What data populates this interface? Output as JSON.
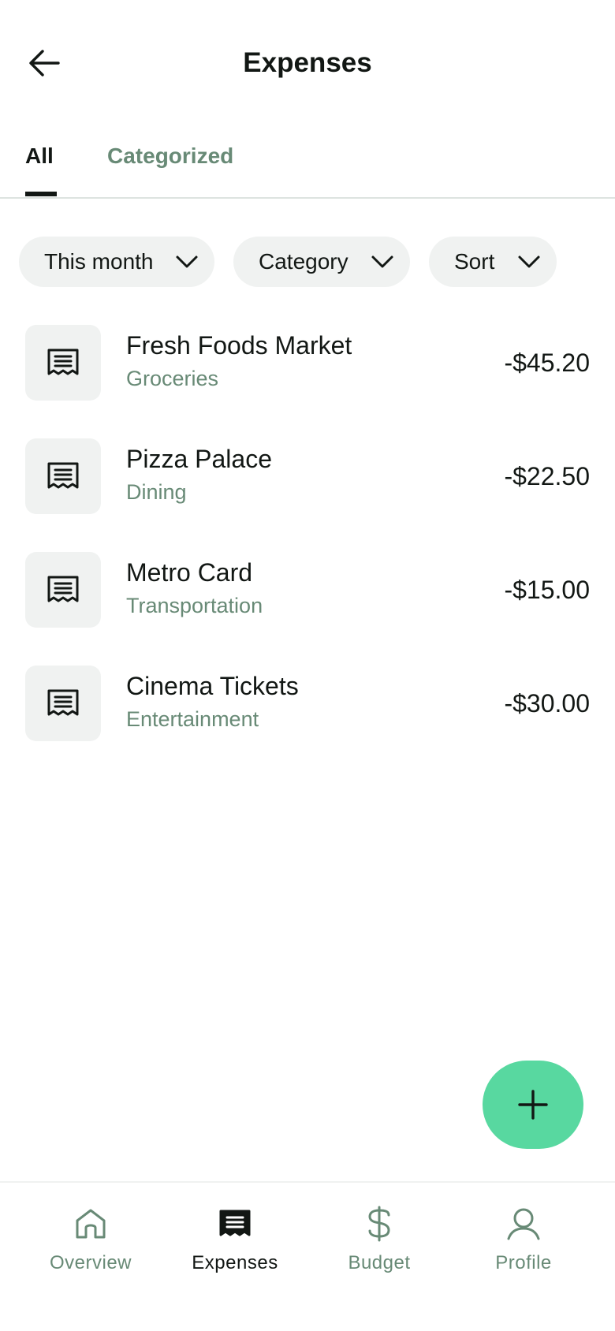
{
  "header": {
    "title": "Expenses",
    "back_icon": "arrow-left-icon"
  },
  "tabs": [
    {
      "label": "All",
      "active": true
    },
    {
      "label": "Categorized",
      "active": false
    }
  ],
  "filters": [
    {
      "label": "This month",
      "icon": "chevron-down-icon"
    },
    {
      "label": "Category",
      "icon": "chevron-down-icon"
    },
    {
      "label": "Sort",
      "icon": "chevron-down-icon"
    }
  ],
  "expenses": [
    {
      "name": "Fresh Foods Market",
      "category": "Groceries",
      "amount": "-$45.20",
      "icon": "receipt-icon"
    },
    {
      "name": "Pizza Palace",
      "category": "Dining",
      "amount": "-$22.50",
      "icon": "receipt-icon"
    },
    {
      "name": "Metro Card",
      "category": "Transportation",
      "amount": "-$15.00",
      "icon": "receipt-icon"
    },
    {
      "name": "Cinema Tickets",
      "category": "Entertainment",
      "amount": "-$30.00",
      "icon": "receipt-icon"
    }
  ],
  "fab": {
    "icon": "plus-icon",
    "color": "#58d8a0"
  },
  "bottom_nav": [
    {
      "label": "Overview",
      "icon": "house-icon",
      "active": false
    },
    {
      "label": "Expenses",
      "icon": "receipt-icon",
      "active": true
    },
    {
      "label": "Budget",
      "icon": "dollar-icon",
      "active": false
    },
    {
      "label": "Profile",
      "icon": "user-icon",
      "active": false
    }
  ],
  "colors": {
    "text_primary": "#121714",
    "text_secondary": "#688a76",
    "surface": "#f0f2f1",
    "accent": "#58d8a0"
  }
}
